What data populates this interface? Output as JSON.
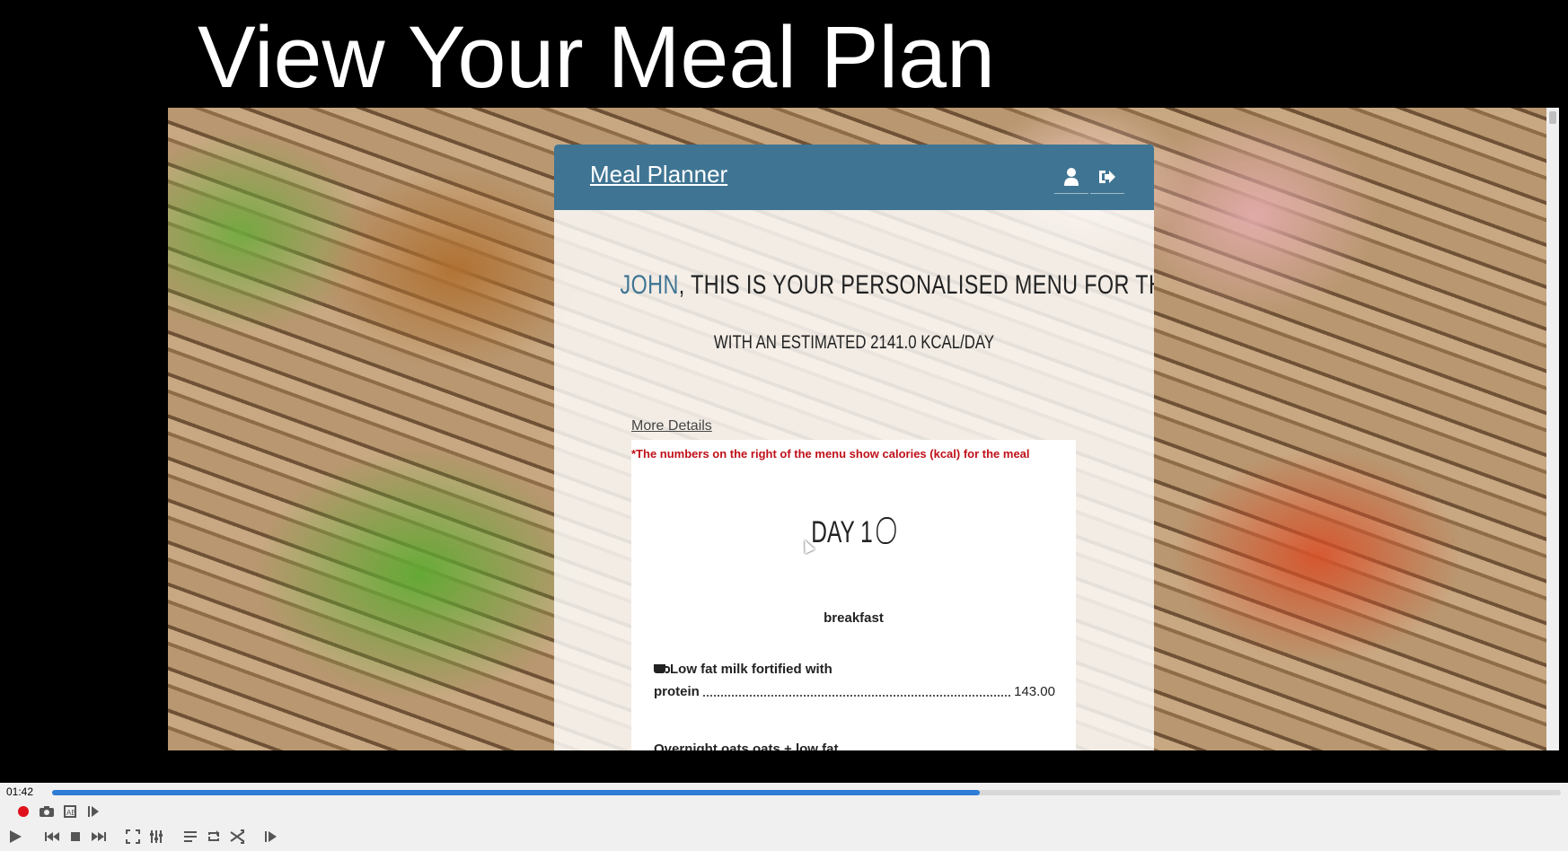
{
  "slide": {
    "title": "View Your Meal Plan"
  },
  "app": {
    "brand": "Meal Planner",
    "greeting_name": "JOHN",
    "greeting_rest": ", THIS IS YOUR PERSONALISED MENU FOR THE WEEK",
    "kcal_line": "WITH AN ESTIMATED 2141.0 KCAL/DAY",
    "more_details": "More Details",
    "note": "*The numbers on the right of the menu show calories (kcal) for the meal",
    "day_title": "DAY 1",
    "meal_label": "breakfast",
    "items": [
      {
        "line1": "Low fat milk fortified with",
        "line2": "protein",
        "kcal": "143.00"
      },
      {
        "line1": "Overnight oats oats + low fat",
        "line2": "",
        "kcal": ""
      }
    ]
  },
  "player": {
    "time": "01:42",
    "progress": 0.615,
    "accent": "#2f7cd6",
    "buttons_row1": [
      "record-icon",
      "snapshot-icon",
      "loop-ab-icon",
      "frame-step-icon"
    ],
    "buttons_row2": [
      "play-icon",
      "previous-icon",
      "stop-icon",
      "next-icon",
      "fullscreen-icon",
      "extended-settings-icon",
      "playlist-icon",
      "loop-icon",
      "shuffle-icon",
      "frame-by-frame-icon"
    ]
  }
}
